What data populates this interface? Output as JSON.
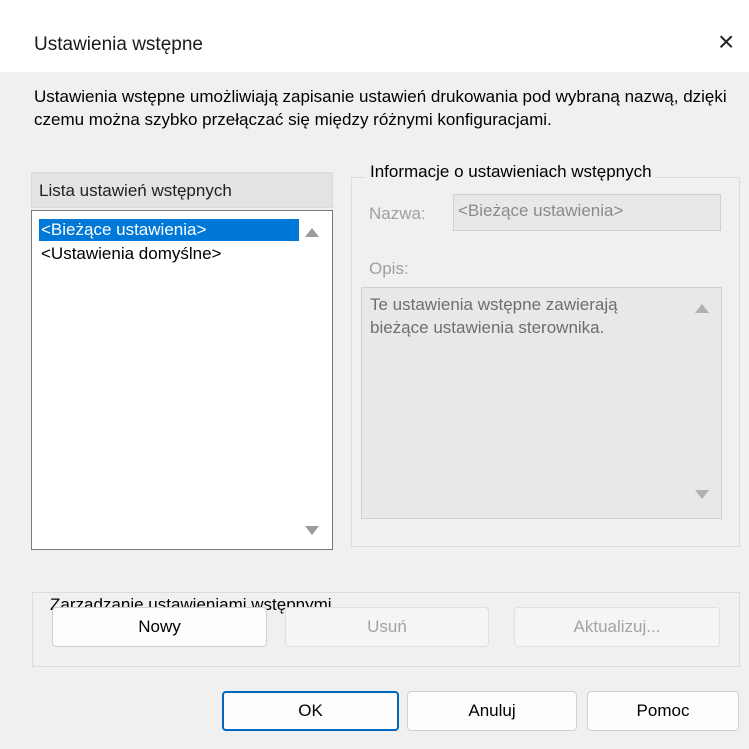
{
  "window": {
    "title": "Ustawienia wstępne",
    "close_icon": "×"
  },
  "description": "Ustawienia wstępne umożliwiają zapisanie ustawień drukowania pod wybraną nazwą, dzięki czemu można szybko przełączać się między różnymi konfiguracjami.",
  "preset_list": {
    "header": "Lista ustawień wstępnych",
    "items": [
      {
        "label": "<Bieżące ustawienia>",
        "selected": true
      },
      {
        "label": "<Ustawienia domyślne>",
        "selected": false
      }
    ]
  },
  "info": {
    "legend": "Informacje o ustawieniach wstępnych",
    "name_label": "Nazwa:",
    "name_value": "<Bieżące ustawienia>",
    "desc_label": "Opis:",
    "desc_value": "Te ustawienia wstępne zawierają bieżące ustawienia sterownika."
  },
  "management": {
    "legend": "Zarządzanie ustawieniami wstępnymi",
    "new_label": "Nowy",
    "delete_label": "Usuń",
    "update_label": "Aktualizuj..."
  },
  "footer": {
    "ok_label": "OK",
    "cancel_label": "Anuluj",
    "help_label": "Pomoc"
  },
  "colors": {
    "selection": "#0078d7",
    "default_button_border": "#0067c0"
  }
}
